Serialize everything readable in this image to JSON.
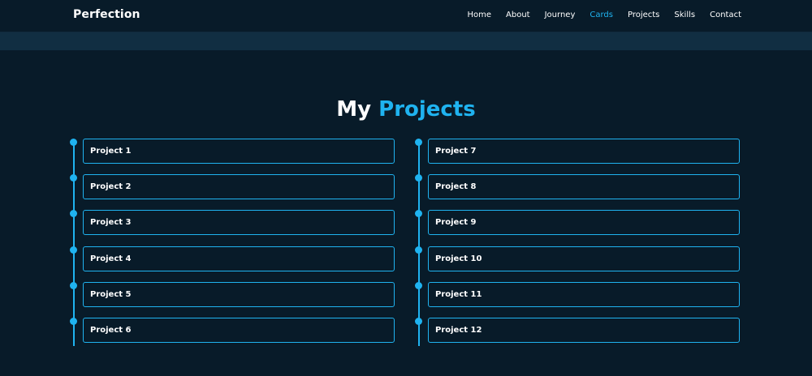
{
  "header": {
    "brand": "Perfection",
    "nav": [
      "Home",
      "About",
      "Journey",
      "Cards",
      "Projects",
      "Skills",
      "Contact"
    ],
    "active_nav": "Cards"
  },
  "section": {
    "title_part1": "My",
    "title_part2": "Projects"
  },
  "projects": {
    "left": [
      "Project 1",
      "Project 2",
      "Project 3",
      "Project 4",
      "Project 5",
      "Project 6"
    ],
    "right": [
      "Project 7",
      "Project 8",
      "Project 9",
      "Project 10",
      "Project 11",
      "Project 12"
    ]
  },
  "colors": {
    "background": "#081b29",
    "accent": "#1fb3f0",
    "subbar": "#112e42",
    "text": "#ffffff"
  }
}
